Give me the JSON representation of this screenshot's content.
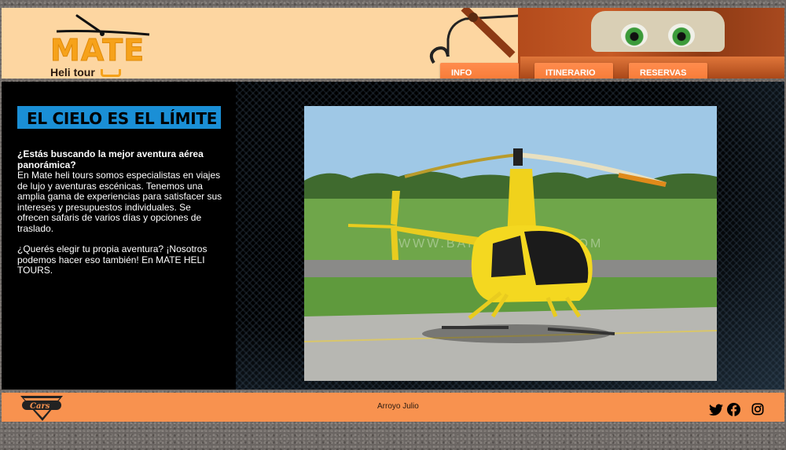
{
  "brand": {
    "logo_text": "MATE",
    "logo_subtitle": "Heli tour"
  },
  "nav": {
    "items": [
      {
        "label": "INFO"
      },
      {
        "label": "ITINERARIO"
      },
      {
        "label": "RESERVAS"
      }
    ]
  },
  "main": {
    "title": "EL CIELO ES EL LÍMITE",
    "question": "¿Estás buscando la mejor aventura aérea panorámica?",
    "paragraph1": "En Mate heli tours somos especialistas en viajes de lujo y aventuras escénicas. Tenemos una amplia gama de experiencias para satisfacer sus intereses y presupuestos individuales. Se ofrecen safaris de varios días y opciones de traslado.",
    "paragraph2": "¿Querés elegir tu propia aventura? ¡Nosotros podemos hacer eso también! En MATE HELI TOURS.",
    "photo_watermark": "WWW.BAHELITOURS.COM"
  },
  "footer": {
    "author": "Arroyo Julio",
    "logo_text": "Cars",
    "social": [
      "twitter-icon",
      "facebook-icon",
      "instagram-icon"
    ]
  },
  "colors": {
    "accent": "#f3752f",
    "title_bg": "#1a8fd6",
    "header_bg": "#fdd6a1",
    "footer_bg": "#f8924f"
  }
}
